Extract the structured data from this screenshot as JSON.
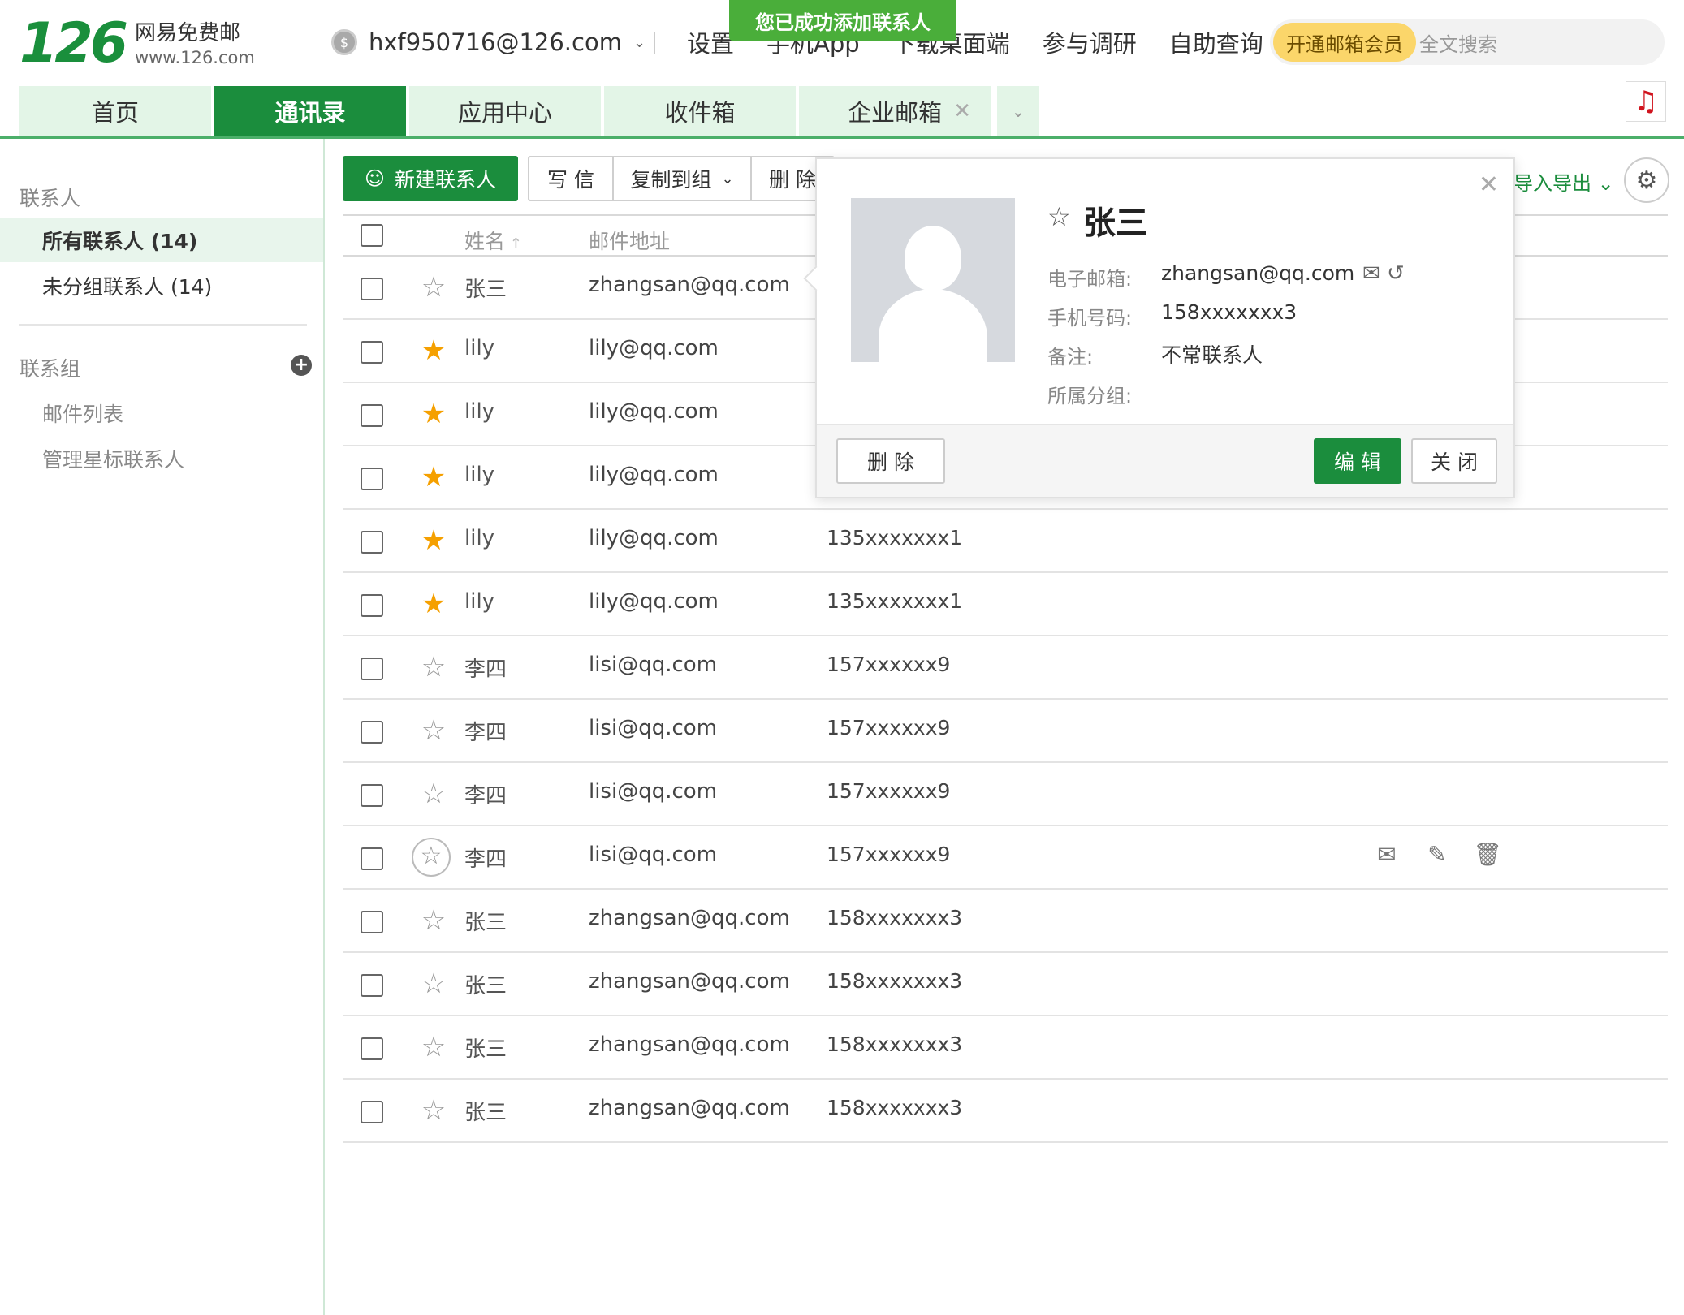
{
  "header": {
    "logo_number": "126",
    "logo_cn": "网易免费邮",
    "logo_url": "www.126.com",
    "account": "hxf950716@126.com",
    "nav": [
      "设置",
      "手机App",
      "下载桌面端",
      "参与调研",
      "自助查询"
    ],
    "toast": "您已成功添加联系人",
    "vip_label": "开通邮箱会员",
    "search_placeholder": "全文搜索"
  },
  "tabs": [
    {
      "label": "首页",
      "active": false
    },
    {
      "label": "通讯录",
      "active": true
    },
    {
      "label": "应用中心",
      "active": false
    },
    {
      "label": "收件箱",
      "active": false
    },
    {
      "label": "企业邮箱",
      "active": false,
      "closable": true
    }
  ],
  "sidebar": {
    "contacts_heading": "联系人",
    "all_contacts": "所有联系人 (14)",
    "ungrouped": "未分组联系人 (14)",
    "groups_heading": "联系组",
    "mail_list": "邮件列表",
    "manage_starred": "管理星标联系人"
  },
  "toolbar": {
    "new_contact": "新建联系人",
    "write": "写 信",
    "copy_to_group": "复制到组",
    "delete": "删 除",
    "import_export": "导入导出"
  },
  "table": {
    "col_name": "姓名",
    "col_email": "邮件地址",
    "rows": [
      {
        "starred": false,
        "name": "张三",
        "email": "zhangsan@qq.com",
        "phone": ""
      },
      {
        "starred": true,
        "name": "lily",
        "email": "lily@qq.com",
        "phone": ""
      },
      {
        "starred": true,
        "name": "lily",
        "email": "lily@qq.com",
        "phone": ""
      },
      {
        "starred": true,
        "name": "lily",
        "email": "lily@qq.com",
        "phone": ""
      },
      {
        "starred": true,
        "name": "lily",
        "email": "lily@qq.com",
        "phone": "135xxxxxxx1"
      },
      {
        "starred": true,
        "name": "lily",
        "email": "lily@qq.com",
        "phone": "135xxxxxxx1"
      },
      {
        "starred": false,
        "name": "李四",
        "email": "lisi@qq.com",
        "phone": "157xxxxxx9"
      },
      {
        "starred": false,
        "name": "李四",
        "email": "lisi@qq.com",
        "phone": "157xxxxxx9"
      },
      {
        "starred": false,
        "name": "李四",
        "email": "lisi@qq.com",
        "phone": "157xxxxxx9"
      },
      {
        "starred": false,
        "name": "李四",
        "email": "lisi@qq.com",
        "phone": "157xxxxxx9",
        "hover": true
      },
      {
        "starred": false,
        "name": "张三",
        "email": "zhangsan@qq.com",
        "phone": "158xxxxxxx3"
      },
      {
        "starred": false,
        "name": "张三",
        "email": "zhangsan@qq.com",
        "phone": "158xxxxxxx3"
      },
      {
        "starred": false,
        "name": "张三",
        "email": "zhangsan@qq.com",
        "phone": "158xxxxxxx3"
      },
      {
        "starred": false,
        "name": "张三",
        "email": "zhangsan@qq.com",
        "phone": "158xxxxxxx3"
      }
    ]
  },
  "card": {
    "name": "张三",
    "email_label": "电子邮箱:",
    "email": "zhangsan@qq.com",
    "phone_label": "手机号码:",
    "phone": "158xxxxxxx3",
    "note_label": "备注:",
    "note": "不常联系人",
    "group_label": "所属分组:",
    "group": "",
    "delete": "删 除",
    "edit": "编 辑",
    "close": "关 闭"
  },
  "colors": {
    "brand_green": "#1b8d3d",
    "star_active": "#f5a000",
    "toast_green": "#4aae3a",
    "vip_yellow": "#fbd66a"
  }
}
